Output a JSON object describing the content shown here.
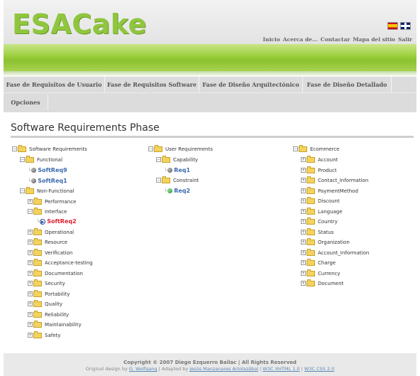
{
  "header": {
    "logo": "ESACake",
    "links": [
      "Inicio",
      "Acerca de...",
      "Contactar",
      "Mapa del sitio",
      "Salir"
    ],
    "flags": [
      "es-flag-icon",
      "uk-flag-icon"
    ]
  },
  "menu": {
    "row1": [
      "Fase de Requisitos de Usuario",
      "Fase de Requisitos Software",
      "Fase de Diseño Arquitectónico",
      "Fase de Diseño Detallado"
    ],
    "row2": [
      "Opciones"
    ]
  },
  "page_title": "Software Requirements Phase",
  "tree_software": {
    "root": "Software Requirements",
    "functional": "Functional",
    "softreq9": "SoftReq9",
    "softreq1": "SoftReq1",
    "nonfunctional": "Non-Functional",
    "performance": "Performance",
    "interface": "Interface",
    "softreq2": "SoftReq2",
    "children": [
      "Operational",
      "Resource",
      "Verification",
      "Acceptance-testing",
      "Documentation",
      "Security",
      "Portability",
      "Quality",
      "Reliability",
      "Maintainability",
      "Safety"
    ]
  },
  "tree_user": {
    "root": "User Requirements",
    "capability": "Capability",
    "req1": "Req1",
    "constraint": "Constraint",
    "req2": "Req2"
  },
  "tree_ecommerce": {
    "root": "Ecommerce",
    "children": [
      "Account",
      "Product",
      "Contact_Information",
      "PaymentMethod",
      "Discount",
      "Language",
      "Country",
      "Status",
      "Organization",
      "Account_Information",
      "Charge",
      "Currency",
      "Document"
    ]
  },
  "footer": {
    "copyright": "Copyright © 2007 Diego Ezquerro Bailac | All Rights Reserved",
    "original_design": "Original design by",
    "designer": "G. Wolfgang",
    "adapted": "| Adapted by",
    "adapter": "Jesús Manzanares Artolazábal",
    "xhtml": "W3C XHTML 1.0",
    "css": "W3C CSS 2.0",
    "sep": "|"
  },
  "colors": {
    "brand_green": "#8fc63e",
    "link_blue": "#3a6ab0",
    "active_red": "#e01d2b"
  }
}
